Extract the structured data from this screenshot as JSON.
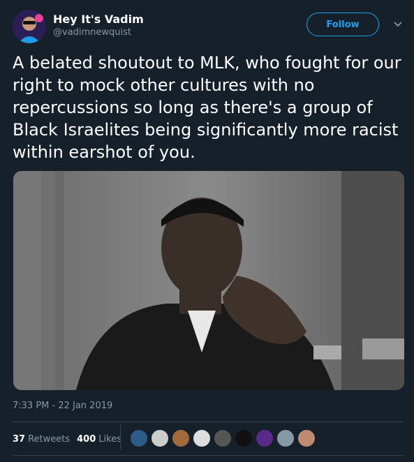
{
  "user": {
    "display_name": "Hey It's Vadim",
    "handle": "@vadimnewquist",
    "avatar_icon": "user-avatar",
    "avatar_color": "#3b2a6b"
  },
  "follow_label": "Follow",
  "caret_icon": "chevron-down-icon",
  "tweet_text": "A belated shoutout to MLK, who fought for our right to mock other cultures with no repercussions so long as there's a group of Black Israelites being significantly more racist within earshot of you.",
  "media": {
    "type": "black-and-white photo"
  },
  "timestamp": "7:33 PM - 22 Jan 2019",
  "stats": {
    "retweets_count": "37",
    "retweets_label": "Retweets",
    "likes_count": "400",
    "likes_label": "Likes"
  },
  "likers": [
    "#2d5c88",
    "#cccccc",
    "#a06a3a",
    "#dddddd",
    "#555555",
    "#111111",
    "#5a2a8a",
    "#8899a6",
    "#c08a70"
  ],
  "colors": {
    "background": "#15202b",
    "accent": "#1da1f2",
    "muted": "#8899a6",
    "divider": "#38444d"
  }
}
